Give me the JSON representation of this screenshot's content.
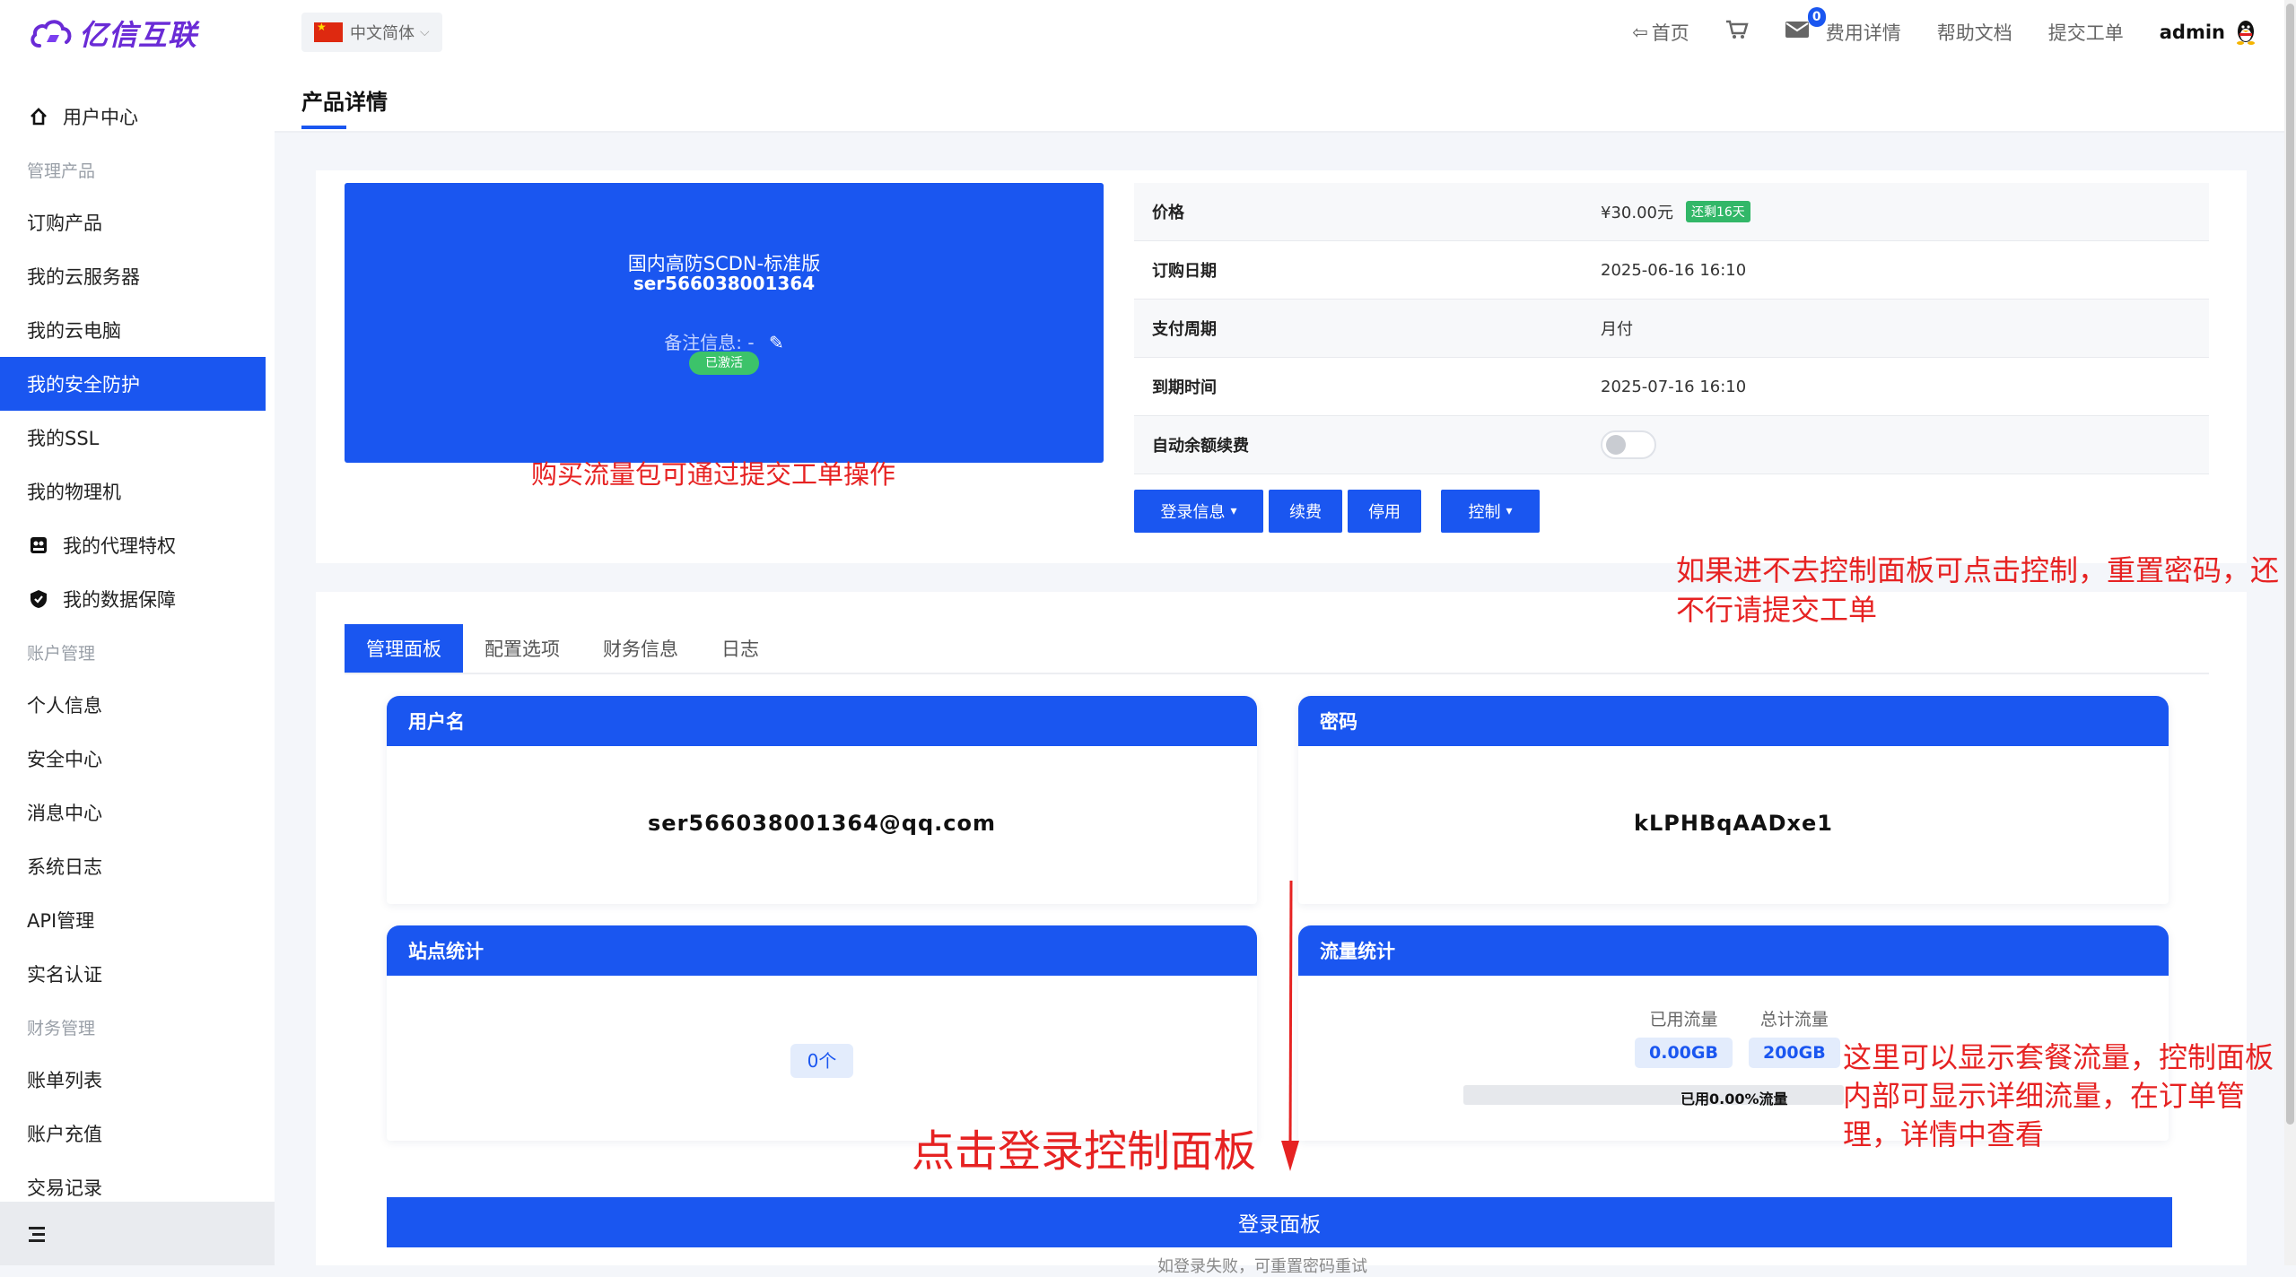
{
  "brand": {
    "name": "亿信互联",
    "color": "#6a2bd6"
  },
  "header": {
    "language": "中文简体",
    "nav": {
      "home": "首页",
      "billing": "费用详情",
      "docs": "帮助文档",
      "ticket": "提交工单"
    },
    "message_count": "0",
    "user": "admin",
    "icons": [
      "back-arrow-icon",
      "cart-icon",
      "mail-icon",
      "qq-penguin-icon"
    ]
  },
  "sidebar": {
    "items": [
      {
        "label": "用户中心",
        "type": "item",
        "icon": "home-icon"
      },
      {
        "label": "管理产品",
        "type": "group"
      },
      {
        "label": "订购产品",
        "type": "item"
      },
      {
        "label": "我的云服务器",
        "type": "item"
      },
      {
        "label": "我的云电脑",
        "type": "item"
      },
      {
        "label": "我的安全防护",
        "type": "item",
        "active": true
      },
      {
        "label": "我的SSL",
        "type": "item"
      },
      {
        "label": "我的物理机",
        "type": "item"
      },
      {
        "label": "我的代理特权",
        "type": "item",
        "icon": "agent-icon"
      },
      {
        "label": "我的数据保障",
        "type": "item",
        "icon": "shield-icon"
      },
      {
        "label": "账户管理",
        "type": "group"
      },
      {
        "label": "个人信息",
        "type": "item"
      },
      {
        "label": "安全中心",
        "type": "item"
      },
      {
        "label": "消息中心",
        "type": "item"
      },
      {
        "label": "系统日志",
        "type": "item"
      },
      {
        "label": "API管理",
        "type": "item"
      },
      {
        "label": "实名认证",
        "type": "item"
      },
      {
        "label": "财务管理",
        "type": "group"
      },
      {
        "label": "账单列表",
        "type": "item"
      },
      {
        "label": "账户充值",
        "type": "item"
      },
      {
        "label": "交易记录",
        "type": "item"
      }
    ],
    "active_color": "#1a56f0"
  },
  "page": {
    "title": "产品详情"
  },
  "product": {
    "name": "国内高防SCDN-标准版",
    "id": "ser566038001364",
    "remark": "备注信息: -",
    "status": "已激活",
    "info": {
      "price_label": "价格",
      "price": "¥30.00元",
      "remaining": "还剩16天",
      "order_date_label": "订购日期",
      "order_date": "2025-06-16 16:10",
      "cycle_label": "支付周期",
      "cycle": "月付",
      "expire_label": "到期时间",
      "expire": "2025-07-16 16:10",
      "autorenew_label": "自动余额续费",
      "autorenew": false
    },
    "buttons": {
      "login_info": "登录信息",
      "renew": "续费",
      "disable": "停用",
      "control": "控制"
    }
  },
  "tabs": [
    "管理面板",
    "配置选项",
    "财务信息",
    "日志"
  ],
  "panels": {
    "username_title": "用户名",
    "username": "ser566038001364@qq.com",
    "password_title": "密码",
    "password": "kLPHBqAADxe1",
    "sites_title": "站点统计",
    "sites": "0个",
    "traffic_title": "流量统计",
    "used_label": "已用流量",
    "used": "0.00GB",
    "total_label": "总计流量",
    "total": "200GB",
    "used_percent": 0.0,
    "used_text": "已用0.00%流量"
  },
  "login_button": "登录面板",
  "bottom_note": "如登录失败，可重置密码重试",
  "annotations": {
    "buy_traffic": "购买流量包可通过提交工单操作",
    "control_help": "如果进不去控制面板可点击控制，重置密码，还不行请提交工单",
    "click_login": "点击登录控制面板",
    "traffic_help": "这里可以显示套餐流量，控制面板内部可显示详细流量，在订单管理，详情中查看",
    "color": "#e62222"
  },
  "theme": {
    "primary": "#1a56f0",
    "success": "#32b768"
  }
}
